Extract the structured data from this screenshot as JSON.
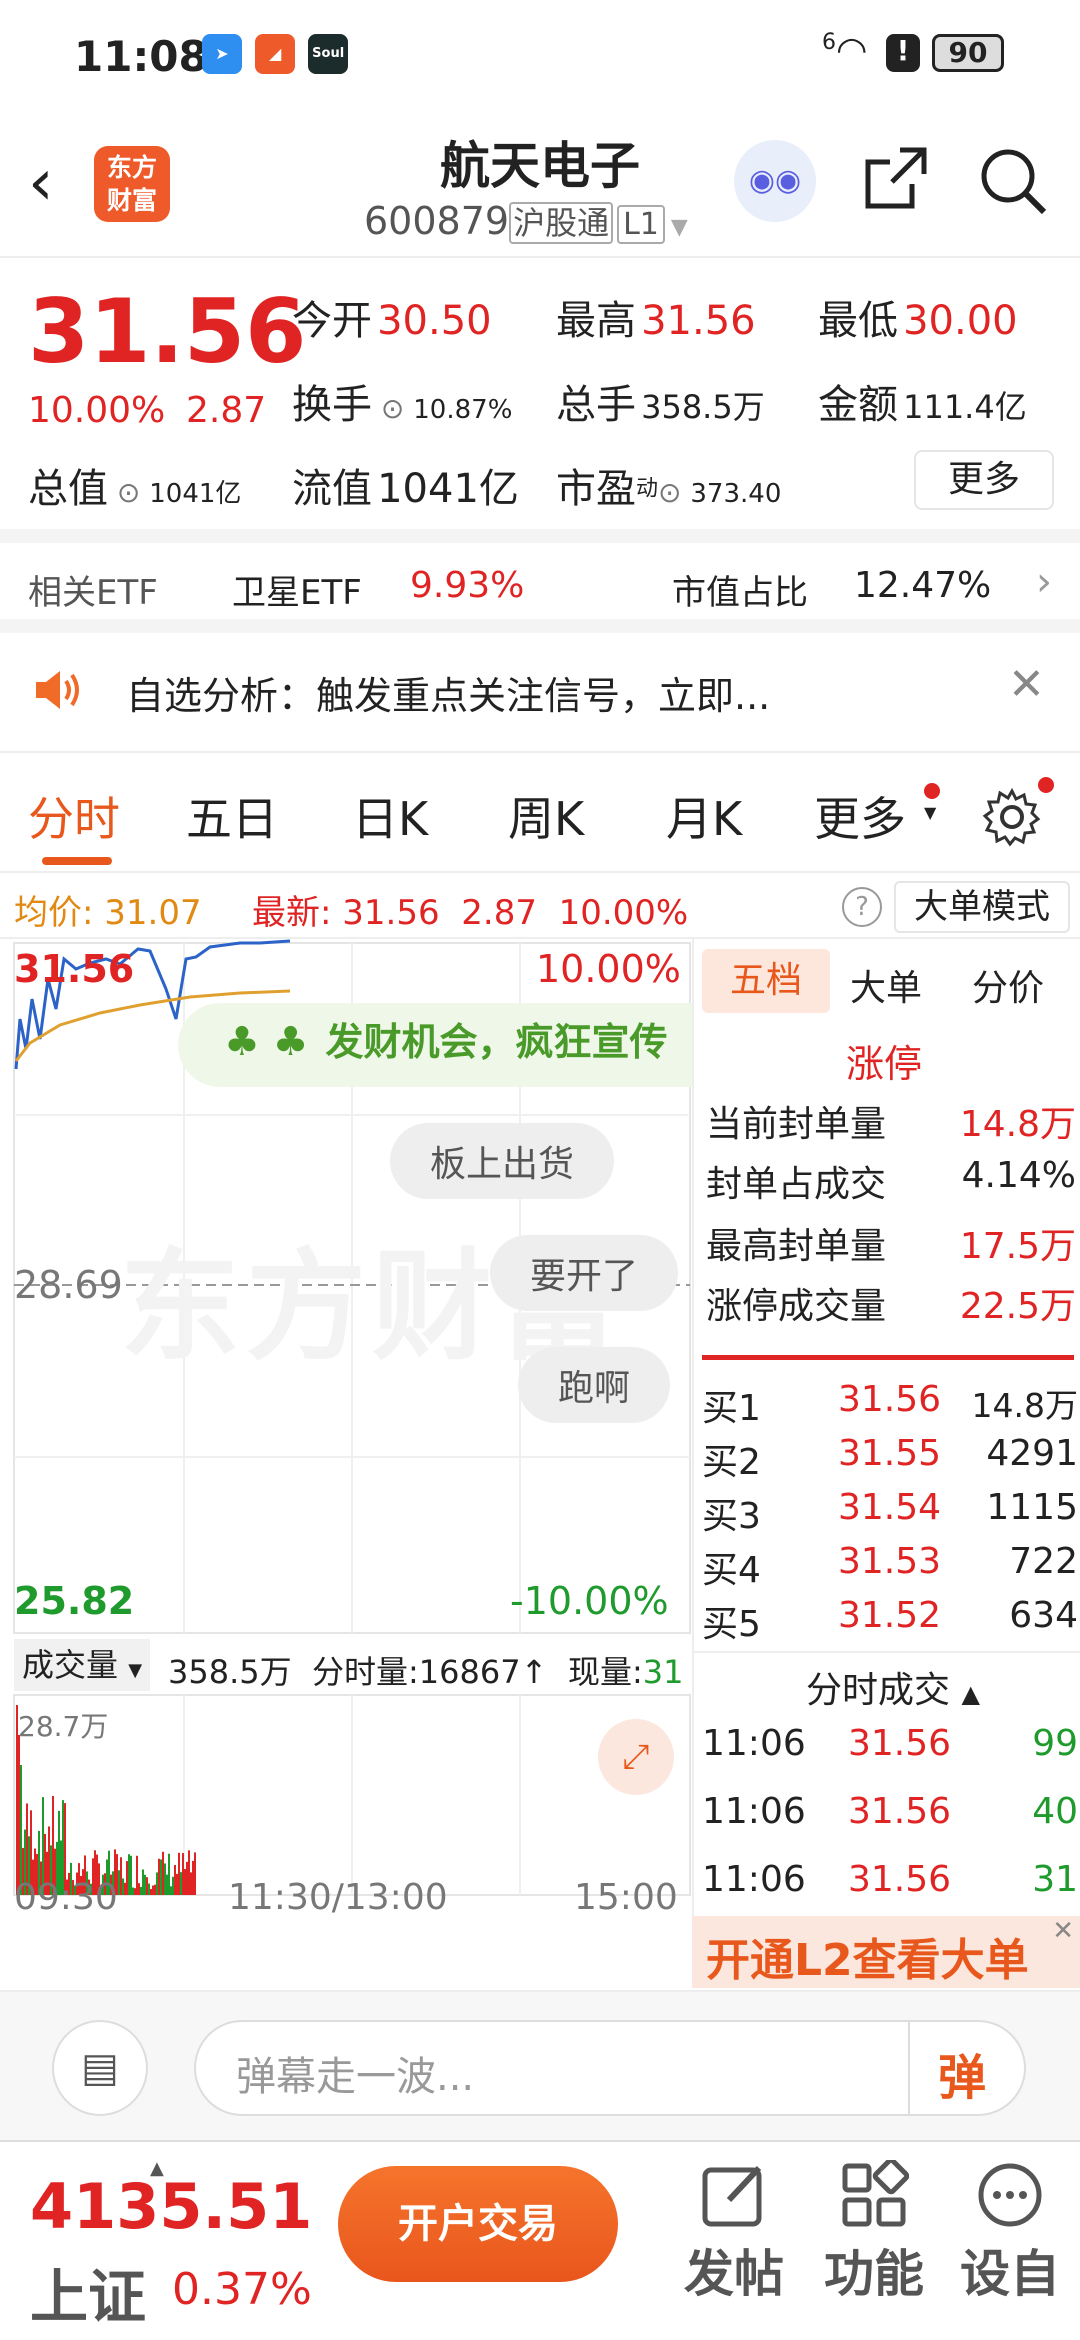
{
  "status": {
    "time": "11:08",
    "app1": "",
    "app2": "",
    "app3": "Soul",
    "wifi": "6",
    "battery": "90"
  },
  "header": {
    "logo_line1": "东方",
    "logo_line2": "财富",
    "title": "航天电子",
    "code": "600879",
    "market": "沪股通",
    "level": "L1"
  },
  "quote": {
    "price": "31.56",
    "pct": "10.00%",
    "chg": "2.87",
    "open_label": "今开",
    "open": "30.50",
    "high_label": "最高",
    "high": "31.56",
    "low_label": "最低",
    "low": "30.00",
    "turnover_label": "换手",
    "turnover": "10.87%",
    "volume_label": "总手",
    "volume": "358.5万",
    "amount_label": "金额",
    "amount": "111.4亿",
    "mcap_label": "总值",
    "mcap": "1041亿",
    "float_label": "流值",
    "float": "1041亿",
    "pe_label": "市盈",
    "pe_sup": "动",
    "pe": "373.40",
    "more": "更多"
  },
  "etf": {
    "label": "相关ETF",
    "name": "卫星ETF",
    "pct": "9.93%",
    "weight_label": "市值占比",
    "weight": "12.47%"
  },
  "notice": {
    "text": "自选分析：触发重点关注信号，立即..."
  },
  "tabs": [
    "分时",
    "五日",
    "日K",
    "周K",
    "月K",
    "更多"
  ],
  "info": {
    "avg_label": "均价:",
    "avg": "31.07",
    "latest_label": "最新:",
    "latest": "31.56",
    "chg": "2.87",
    "pct": "10.00%",
    "mode": "大单模式"
  },
  "chart": {
    "top_price": "31.56",
    "top_pct": "10.00%",
    "mid_price": "28.69",
    "bottom_price": "25.82",
    "bottom_pct": "-10.00%",
    "watermark": "东方财富",
    "promo": "发财机会，疯狂宣传",
    "bubbles": [
      "板上出货",
      "要开了",
      "跑啊"
    ],
    "vol_label": "成交量",
    "vol_total": "358.5万",
    "tick_label": "分时量:",
    "tick": "16867",
    "tick_arrow": "↑",
    "now_label": "现量:",
    "now": "31",
    "vol_max": "28.7万",
    "t_start": "09:30",
    "t_mid": "11:30/13:00",
    "t_end": "15:00"
  },
  "side": {
    "tabs": [
      "五档",
      "大单",
      "分价"
    ],
    "limit_label": "涨停",
    "stats": [
      {
        "k": "当前封单量",
        "v": "14.8万"
      },
      {
        "k": "封单占成交",
        "v": "4.14%"
      },
      {
        "k": "最高封单量",
        "v": "17.5万"
      },
      {
        "k": "涨停成交量",
        "v": "22.5万"
      }
    ],
    "bids": [
      {
        "k": "买1",
        "p": "31.56",
        "q": "14.8万"
      },
      {
        "k": "买2",
        "p": "31.55",
        "q": "4291"
      },
      {
        "k": "买3",
        "p": "31.54",
        "q": "1115"
      },
      {
        "k": "买4",
        "p": "31.53",
        "q": "722"
      },
      {
        "k": "买5",
        "p": "31.52",
        "q": "634"
      }
    ],
    "trades_label": "分时成交",
    "trades": [
      {
        "t": "11:06",
        "p": "31.56",
        "q": "99"
      },
      {
        "t": "11:06",
        "p": "31.56",
        "q": "40"
      },
      {
        "t": "11:06",
        "p": "31.56",
        "q": "31"
      }
    ],
    "l2": "开通L2查看大单"
  },
  "danmu": {
    "placeholder": "弹幕走一波...",
    "send": "弹"
  },
  "bottom": {
    "index_value": "4135.51",
    "index_name": "上证",
    "index_pct": "0.37%",
    "trade": "开户交易",
    "post": "发帖",
    "func": "功能",
    "custom": "设自"
  }
}
